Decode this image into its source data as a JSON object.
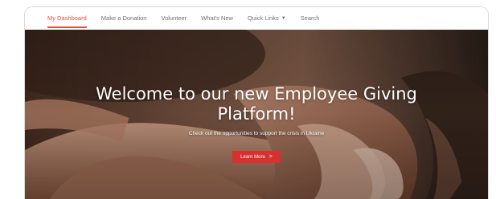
{
  "nav": {
    "items": [
      {
        "label": "My Dashboard",
        "active": true
      },
      {
        "label": "Make a Donation",
        "active": false
      },
      {
        "label": "Volunteer",
        "active": false
      },
      {
        "label": "What's New",
        "active": false
      },
      {
        "label": "Quick Links",
        "active": false,
        "dropdown": true
      },
      {
        "label": "Search",
        "active": false
      }
    ],
    "active_color": "#e0503f"
  },
  "hero": {
    "title": "Welcome to our new Employee Giving Platform!",
    "subtitle": "Check out the opportunities to support the crisis in Ukraine",
    "button_label": "Learn More",
    "button_icon": "chevron-right-icon",
    "button_color": "#d82f2f"
  }
}
